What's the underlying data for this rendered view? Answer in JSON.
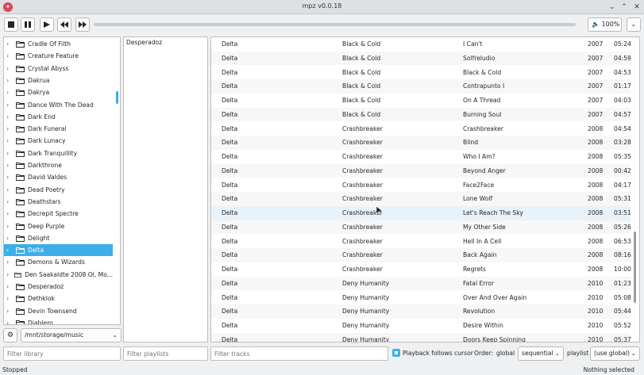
{
  "window": {
    "title": "mpz v0.0.18"
  },
  "toolbar": {
    "volume_label": "100%"
  },
  "library": {
    "items": [
      {
        "label": "Cradle Of Filth",
        "selected": false
      },
      {
        "label": "Creature Feature",
        "selected": false
      },
      {
        "label": "Crystal Abyss",
        "selected": false
      },
      {
        "label": "Dakrua",
        "selected": false
      },
      {
        "label": "Dakrya",
        "selected": false
      },
      {
        "label": "Dance With The Dead",
        "selected": false
      },
      {
        "label": "Dark End",
        "selected": false
      },
      {
        "label": "Dark Funeral",
        "selected": false
      },
      {
        "label": "Dark Lunacy",
        "selected": false
      },
      {
        "label": "Dark Tranquillity",
        "selected": false
      },
      {
        "label": "Darkthrone",
        "selected": false
      },
      {
        "label": "David Valdes",
        "selected": false
      },
      {
        "label": "Dead Poetry",
        "selected": false
      },
      {
        "label": "Deathstars",
        "selected": false
      },
      {
        "label": "Decrepit Spectre",
        "selected": false
      },
      {
        "label": "Deep Purple",
        "selected": false
      },
      {
        "label": "Delight",
        "selected": false
      },
      {
        "label": "Delta",
        "selected": true
      },
      {
        "label": "Demons & Wizards",
        "selected": false
      },
      {
        "label": "Den Saakaldte 2008 Ol, Mo...",
        "selected": false
      },
      {
        "label": "Desperadoz",
        "selected": false
      },
      {
        "label": "Dethklok",
        "selected": false
      },
      {
        "label": "Devin Townsend",
        "selected": false
      },
      {
        "label": "Diablero",
        "selected": false
      }
    ],
    "path": "/mnt/storage/music"
  },
  "playlists": {
    "items": [
      "Desperadoz"
    ]
  },
  "tracks": [
    {
      "artist": "Delta",
      "album": "Black & Cold",
      "title": "I Can't",
      "year": "2007",
      "duration": "05:24"
    },
    {
      "artist": "Delta",
      "album": "Black & Cold",
      "title": "Solfreludio",
      "year": "2007",
      "duration": "04:59"
    },
    {
      "artist": "Delta",
      "album": "Black & Cold",
      "title": "Black & Cold",
      "year": "2007",
      "duration": "04:53"
    },
    {
      "artist": "Delta",
      "album": "Black & Cold",
      "title": "Contrapunto I",
      "year": "2007",
      "duration": "01:17"
    },
    {
      "artist": "Delta",
      "album": "Black & Cold",
      "title": "On A Thread",
      "year": "2007",
      "duration": "04:03"
    },
    {
      "artist": "Delta",
      "album": "Black & Cold",
      "title": "Burning Soul",
      "year": "2007",
      "duration": "04:57"
    },
    {
      "artist": "Delta",
      "album": "Crashbreaker",
      "title": "Crashbreaker",
      "year": "2008",
      "duration": "04:54"
    },
    {
      "artist": "Delta",
      "album": "Crashbreaker",
      "title": "Blind",
      "year": "2008",
      "duration": "03:28"
    },
    {
      "artist": "Delta",
      "album": "Crashbreaker",
      "title": "Who I Am?",
      "year": "2008",
      "duration": "05:35"
    },
    {
      "artist": "Delta",
      "album": "Crashbreaker",
      "title": "Beyond Anger",
      "year": "2008",
      "duration": "00:42"
    },
    {
      "artist": "Delta",
      "album": "Crashbreaker",
      "title": "Face2Face",
      "year": "2008",
      "duration": "04:17"
    },
    {
      "artist": "Delta",
      "album": "Crashbreaker",
      "title": "Lone Wolf",
      "year": "2008",
      "duration": "05:31"
    },
    {
      "artist": "Delta",
      "album": "Crashbreaker",
      "title": "Let's Reach The Sky",
      "year": "2008",
      "duration": "03:51"
    },
    {
      "artist": "Delta",
      "album": "Crashbreaker",
      "title": "My Other Side",
      "year": "2008",
      "duration": "05:26"
    },
    {
      "artist": "Delta",
      "album": "Crashbreaker",
      "title": "Hell In A Cell",
      "year": "2008",
      "duration": "06:53"
    },
    {
      "artist": "Delta",
      "album": "Crashbreaker",
      "title": "Back Again",
      "year": "2008",
      "duration": "08:16"
    },
    {
      "artist": "Delta",
      "album": "Crashbreaker",
      "title": "Regrets",
      "year": "2008",
      "duration": "10:00"
    },
    {
      "artist": "Delta",
      "album": "Deny Humanity",
      "title": "Fatal Error",
      "year": "2010",
      "duration": "01:23"
    },
    {
      "artist": "Delta",
      "album": "Deny Humanity",
      "title": "Over And Over Again",
      "year": "2010",
      "duration": "05:08"
    },
    {
      "artist": "Delta",
      "album": "Deny Humanity",
      "title": "Revolution",
      "year": "2010",
      "duration": "05:44"
    },
    {
      "artist": "Delta",
      "album": "Deny Humanity",
      "title": "Desire Within",
      "year": "2010",
      "duration": "05:52"
    },
    {
      "artist": "Delta",
      "album": "Deny Humanity",
      "title": "Doors Keep Spinning",
      "year": "2010",
      "duration": "05:37"
    }
  ],
  "filters": {
    "library_placeholder": "Filter library",
    "playlists_placeholder": "Filter playlists",
    "tracks_placeholder": "Filter tracks"
  },
  "options": {
    "follow_label": "Playback follows cursor",
    "follow_checked": true,
    "order_label": "Order:",
    "order_scope": "global",
    "order_value": "sequential",
    "playlist_label": "playlist",
    "playlist_value": "(use global)"
  },
  "status": {
    "left": "Stopped",
    "right": "Nothing selected"
  },
  "colors": {
    "accent": "#3daee9",
    "close": "#da4453"
  }
}
